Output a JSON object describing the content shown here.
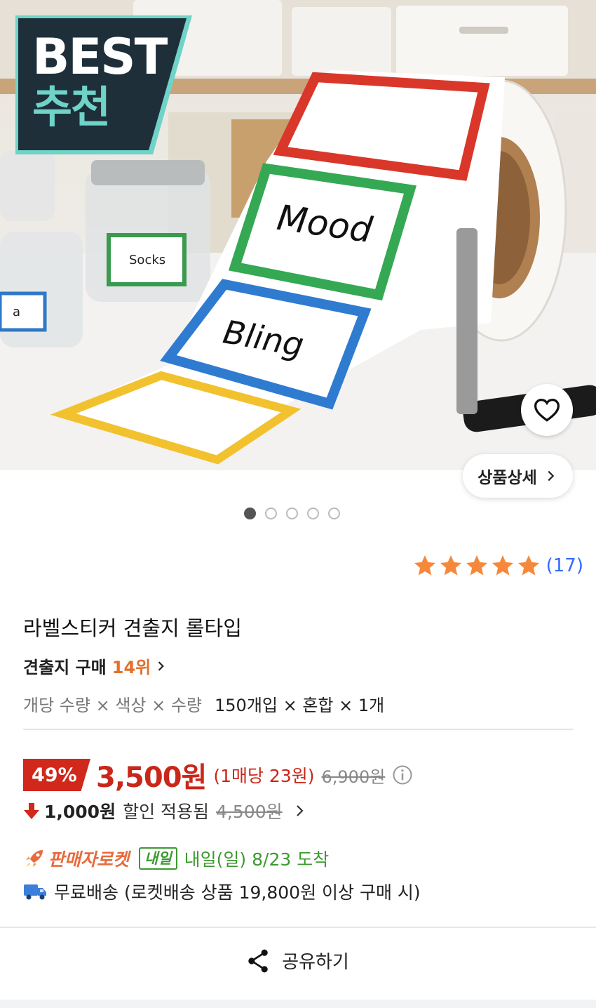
{
  "hero": {
    "badge_line1": "BEST",
    "badge_line2": "추천",
    "label_texts": [
      "Mood",
      "Bling",
      "Socks",
      "a"
    ],
    "detail_button": "상품상세",
    "slide_count": 5,
    "active_slide": 1
  },
  "rating": {
    "stars": 5,
    "count": "(17)"
  },
  "product": {
    "title": "라벨스티커 견출지 롤타입",
    "rank_label": "견출지 구매",
    "rank_value": "14위",
    "options_label": "개당 수량 × 색상 × 수량",
    "options_value": "150개입 × 혼합 × 1개"
  },
  "price": {
    "discount": "49%",
    "current": "3,500원",
    "unit": "(1매당 23원)",
    "original": "6,900원"
  },
  "coupon": {
    "amount": "1,000원",
    "text": "할인 적용됨",
    "before": "4,500원"
  },
  "delivery": {
    "rocket_label": "판매자로켓",
    "badge": "내일",
    "arrival": "내일(일) 8/23 도착",
    "shipping": "무료배송 (로켓배송 상품 19,800원 이상 구매 시)"
  },
  "share_label": "공유하기",
  "colors": {
    "accent_red": "#c9271a",
    "rocket_orange": "#e86b3b",
    "green": "#3c9a2f",
    "star": "#f5883a",
    "link_blue": "#346aff"
  }
}
